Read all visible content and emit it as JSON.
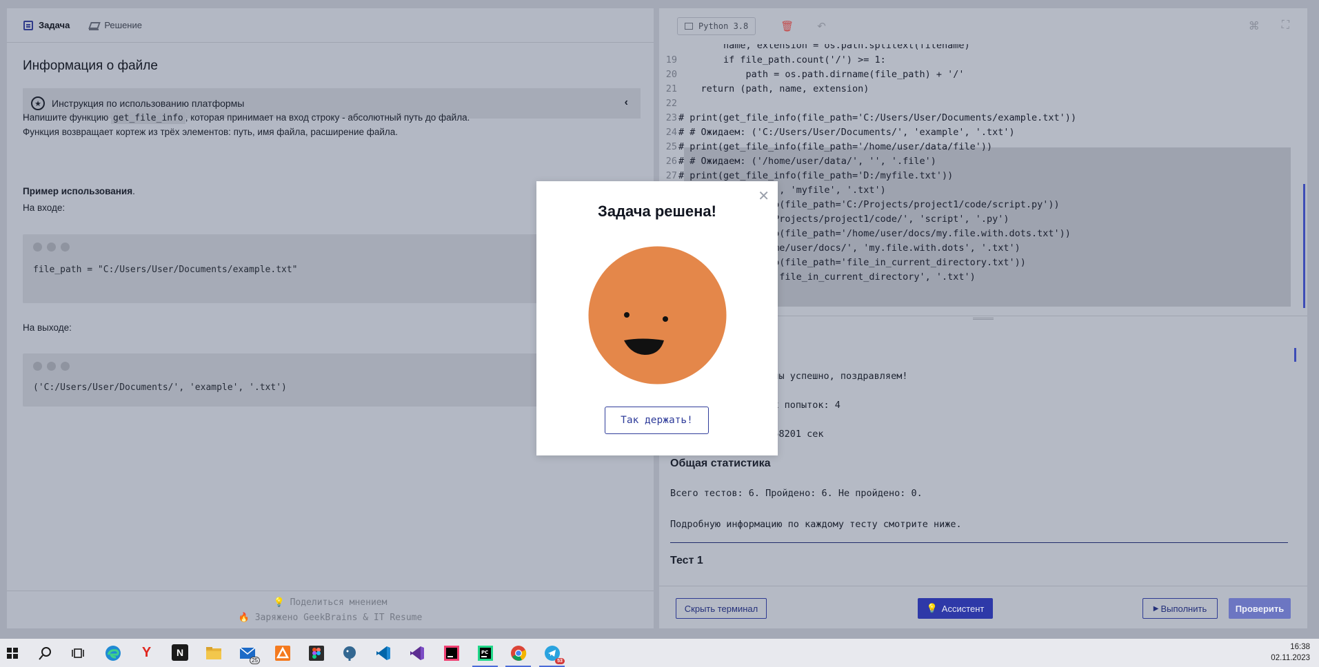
{
  "left": {
    "tabs": [
      {
        "label": "Задача",
        "icon": "document-icon"
      },
      {
        "label": "Решение",
        "icon": "graduation-cap-icon"
      }
    ],
    "title": "Информация о файле",
    "instruction": "Инструкция по использованию платформы",
    "desc_prefix": "Напишите функцию ",
    "desc_func": "get_file_info",
    "desc_suffix": ", которая принимает на вход строку - абсолютный путь до файла.",
    "desc_line2": "Функция возвращает кортеж из трёх элементов: путь, имя файла, расширение файла.",
    "example_heading": "Пример использования",
    "example_heading_dot": ".",
    "input_label": "На входе:",
    "input_code": "file_path = \"C:/Users/User/Documents/example.txt\"",
    "output_label": "На выходе:",
    "output_code": "('C:/Users/User/Documents/', 'example', '.txt')",
    "footer_feedback": "Поделиться мнением",
    "footer_powered": "Заряжено GeekBrains & IT Resume"
  },
  "editor": {
    "language": "Python 3.8",
    "lines": [
      {
        "n": "",
        "text": "        name, extension = os.path.splitext(filename)"
      },
      {
        "n": "19",
        "text": "        if file_path.count('/') >= 1:"
      },
      {
        "n": "20",
        "text": "            path = os.path.dirname(file_path) + '/'"
      },
      {
        "n": "21",
        "text": "    return (path, name, extension)"
      },
      {
        "n": "22",
        "text": ""
      },
      {
        "n": "23",
        "text": "# print(get_file_info(file_path='C:/Users/User/Documents/example.txt'))"
      },
      {
        "n": "24",
        "text": "# # Ожидаем: ('C:/Users/User/Documents/', 'example', '.txt')"
      },
      {
        "n": "25",
        "text": "# print(get_file_info(file_path='/home/user/data/file'))"
      },
      {
        "n": "26",
        "text": "# # Ожидаем: ('/home/user/data/', '', '.file')"
      },
      {
        "n": "27",
        "text": "# print(get_file_info(file_path='D:/myfile.txt'))"
      },
      {
        "n": "",
        "text": "             'D:/', 'myfile', '.txt')"
      },
      {
        "n": "",
        "text": "             _info(file_path='C:/Projects/project1/code/script.py'))"
      },
      {
        "n": "",
        "text": "             'C:/Projects/project1/code/', 'script', '.py')"
      },
      {
        "n": "",
        "text": "             _info(file_path='/home/user/docs/my.file.with.dots.txt'))"
      },
      {
        "n": "",
        "text": "             '/home/user/docs/', 'my.file.with.dots', '.txt')"
      },
      {
        "n": "",
        "text": "             _info(file_path='file_in_current_directory.txt'))"
      },
      {
        "n": "",
        "text": "             '', 'file_in_current_directory', '.txt')"
      }
    ]
  },
  "terminal": {
    "line1": "йдены успешно, поздравляем!",
    "line2": "нных попыток: 4",
    "line3": "1.358201 сек",
    "stats_heading": "Общая статистика",
    "stats_line": "Всего тестов: 6. Пройдено: 6. Не пройдено: 0.",
    "details_line": "Подробную информацию по каждому тесту смотрите ниже.",
    "test_heading": "Тест 1"
  },
  "buttons": {
    "hide_terminal": "Скрыть терминал",
    "assistant": "Ассистент",
    "run": "Выполнить",
    "check": "Проверить"
  },
  "modal": {
    "title": "Задача решена!",
    "button": "Так держать!",
    "smiley_color": "#e4874a"
  },
  "taskbar": {
    "mail_badge": "25",
    "telegram_badge": "53",
    "time": "16:38",
    "date": "02.11.2023"
  }
}
